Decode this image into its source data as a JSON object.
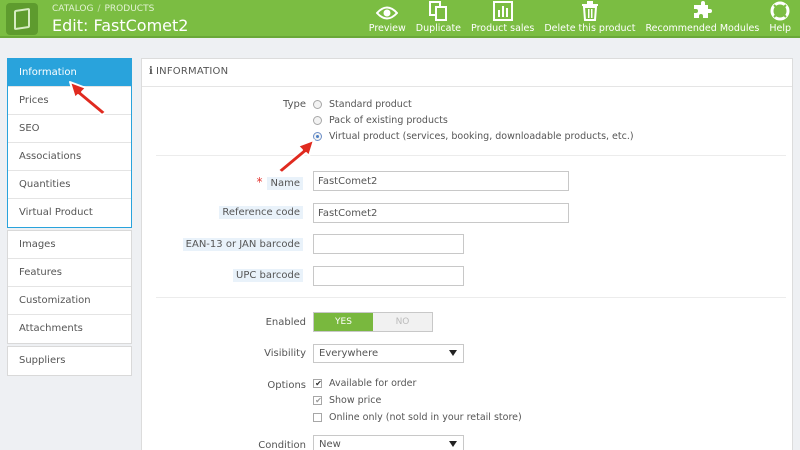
{
  "header": {
    "breadcrumb": [
      "CATALOG",
      "PRODUCTS"
    ],
    "breadcrumb_sep": "/",
    "title": "Edit: FastComet2",
    "toolbar": [
      {
        "label": "Preview",
        "icon": "eye-icon"
      },
      {
        "label": "Duplicate",
        "icon": "copy-icon"
      },
      {
        "label": "Product sales",
        "icon": "bar-chart-icon"
      },
      {
        "label": "Delete this product",
        "icon": "trash-icon"
      },
      {
        "label": "Recommended Modules",
        "icon": "puzzle-icon"
      },
      {
        "label": "Help",
        "icon": "lifebuoy-icon"
      }
    ]
  },
  "sidebar": {
    "groups": [
      [
        "Information",
        "Prices",
        "SEO",
        "Associations",
        "Quantities",
        "Virtual Product"
      ],
      [
        "Images",
        "Features",
        "Customization",
        "Attachments"
      ],
      [
        "Suppliers"
      ]
    ],
    "active": "Information"
  },
  "panel": {
    "icon": "i",
    "title": "INFORMATION",
    "type": {
      "label": "Type",
      "options": [
        {
          "label": "Standard product",
          "checked": false
        },
        {
          "label": "Pack of existing products",
          "checked": false
        },
        {
          "label": "Virtual product (services, booking, downloadable products, etc.)",
          "checked": true
        }
      ]
    },
    "fields": {
      "name": {
        "label": "Name",
        "required_mark": "*",
        "value": "FastComet2"
      },
      "reference": {
        "label": "Reference code",
        "value": "FastComet2"
      },
      "ean": {
        "label": "EAN-13 or JAN barcode",
        "value": ""
      },
      "upc": {
        "label": "UPC barcode",
        "value": ""
      }
    },
    "enabled": {
      "label": "Enabled",
      "yes": "YES",
      "no": "NO",
      "value": "YES"
    },
    "visibility": {
      "label": "Visibility",
      "value": "Everywhere"
    },
    "options": {
      "label": "Options",
      "items": [
        {
          "label": "Available for order",
          "checked": true
        },
        {
          "label": "Show price",
          "checked": true
        },
        {
          "label": "Online only (not sold in your retail store)",
          "checked": false
        }
      ]
    },
    "condition": {
      "label": "Condition",
      "value": "New"
    }
  },
  "colors": {
    "header": "#7bbd42",
    "active_tab": "#29a3dc",
    "toggle_on": "#79b83e",
    "arrow": "#e02a1f"
  }
}
